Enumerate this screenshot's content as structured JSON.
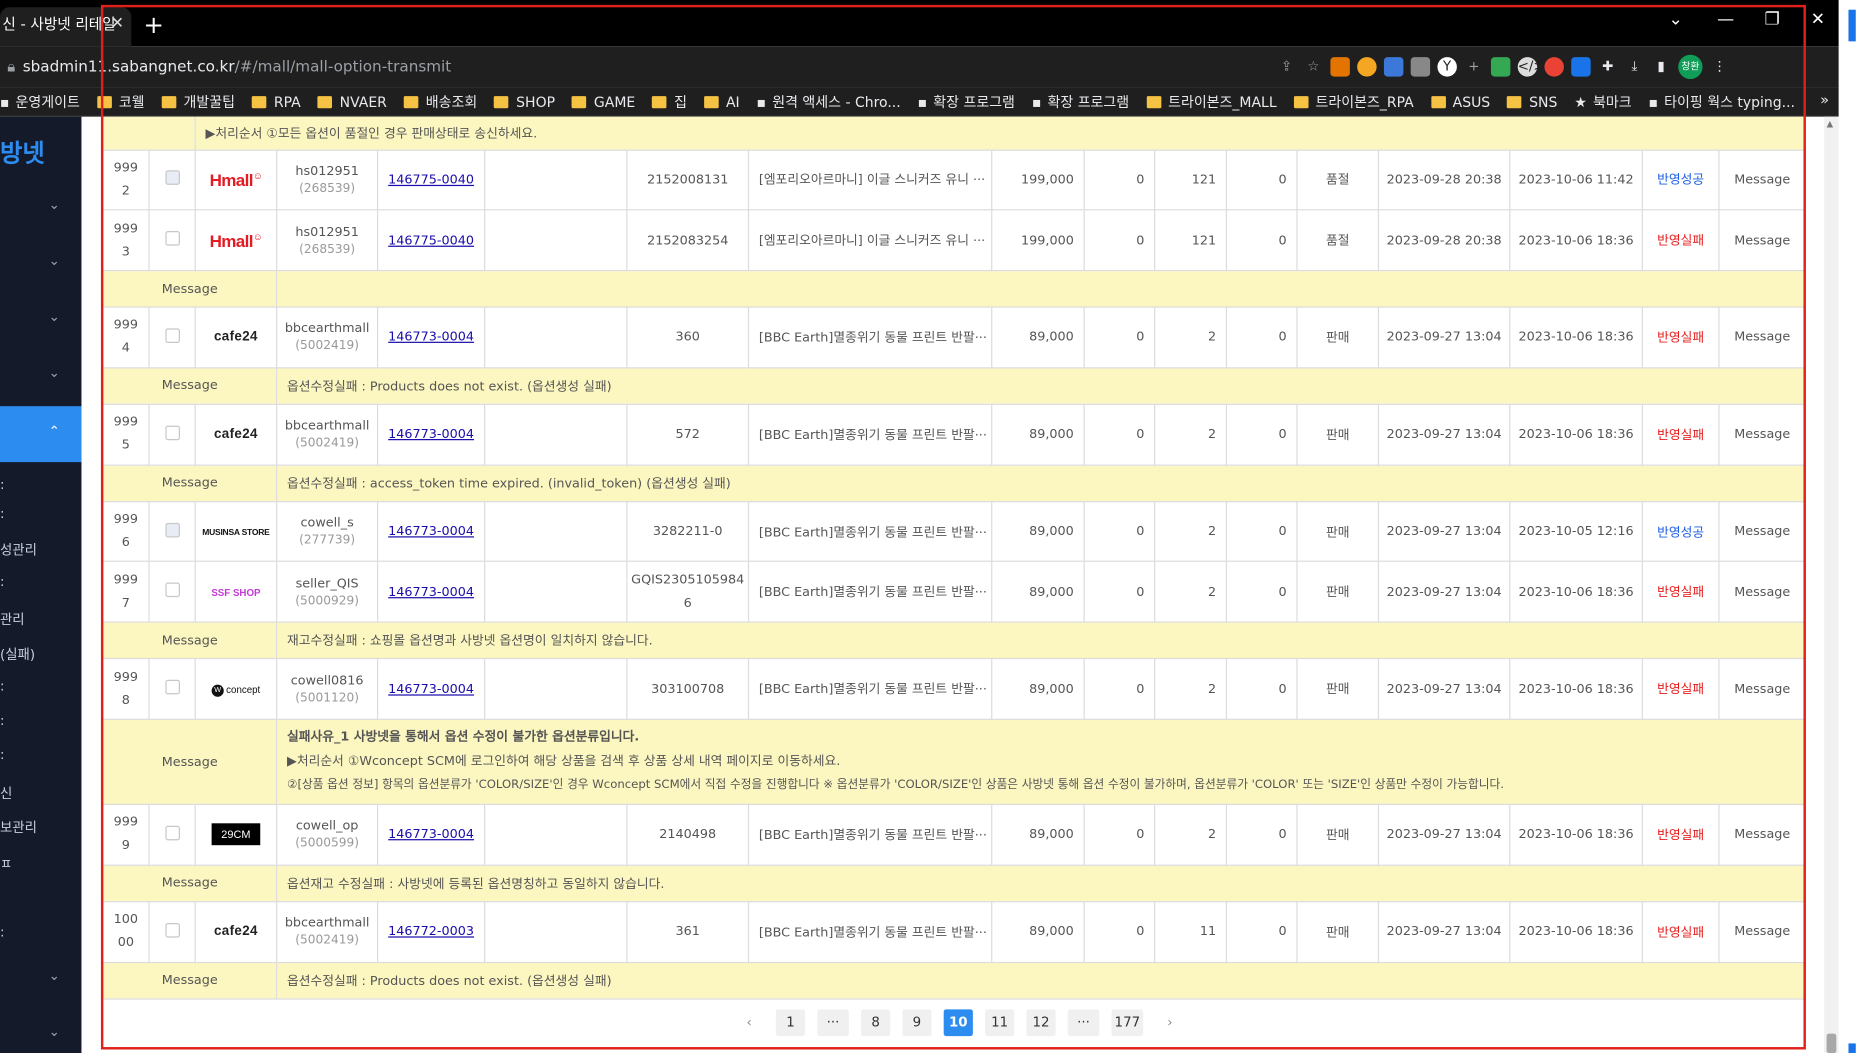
{
  "browser": {
    "tab_title": "신 - 사방넷 리테일",
    "tab_close": "✕",
    "new_tab": "+",
    "url_host": "sbadmin11.sabangnet.co.kr",
    "url_path": "/#/mall/mall-option-transmit",
    "window_controls": [
      "⌄",
      "—",
      "❐",
      "✕"
    ],
    "profile": "창환",
    "bookmarks": [
      {
        "label": "운영게이트",
        "icon": "site-icon"
      },
      {
        "label": "코웰",
        "icon": "folder-icon"
      },
      {
        "label": "개발꿀팁",
        "icon": "folder-icon"
      },
      {
        "label": "RPA",
        "icon": "folder-icon"
      },
      {
        "label": "NVAER",
        "icon": "folder-icon"
      },
      {
        "label": "배송조회",
        "icon": "folder-icon"
      },
      {
        "label": "SHOP",
        "icon": "folder-icon"
      },
      {
        "label": "GAME",
        "icon": "folder-icon"
      },
      {
        "label": "집",
        "icon": "folder-icon"
      },
      {
        "label": "AI",
        "icon": "folder-icon"
      },
      {
        "label": "원격 액세스 - Chro...",
        "icon": "remote-icon"
      },
      {
        "label": "확장 프로그램",
        "icon": "ext-icon"
      },
      {
        "label": "확장 프로그램",
        "icon": "puzzle-icon"
      },
      {
        "label": "트라이본즈_MALL",
        "icon": "folder-icon"
      },
      {
        "label": "트라이본즈_RPA",
        "icon": "folder-icon"
      },
      {
        "label": "ASUS",
        "icon": "folder-icon"
      },
      {
        "label": "SNS",
        "icon": "folder-icon"
      },
      {
        "label": "북마크",
        "icon": "star-icon"
      },
      {
        "label": "타이핑 웍스 typing...",
        "icon": "page-icon"
      }
    ],
    "bookmarks_more": "»"
  },
  "sidebar": {
    "logo": "방넷",
    "items": [
      "성관리",
      "관리",
      "(실패)",
      "신",
      "보관리",
      "ㅍ"
    ]
  },
  "table": {
    "top_message": "▶처리순서 ①모든 옵션이 품절인 경우 판매상태로 송신하세요.",
    "message_label": "Message",
    "rows": [
      {
        "no": [
          "999",
          "2"
        ],
        "mall": "Hmall",
        "account": "hs012951",
        "account_id": "(268539)",
        "code": "146775-0040",
        "opt": "",
        "mall_code": "2152008131",
        "product": "[엠포리오아르마니] 이글 스니커즈 유니 ···",
        "price": "199,000",
        "c1": "0",
        "c2": "121",
        "c3": "0",
        "status": "품절",
        "date1": "2023-09-28 20:38",
        "date2": "2023-10-06 11:42",
        "result": "반영성공",
        "result_type": "ok",
        "msg_btn": "Message",
        "checkbox_dim": true
      },
      {
        "no": [
          "999",
          "3"
        ],
        "mall": "Hmall",
        "account": "hs012951",
        "account_id": "(268539)",
        "code": "146775-0040",
        "opt": "",
        "mall_code": "2152083254",
        "product": "[엠포리오아르마니] 이글 스니커즈 유니 ···",
        "price": "199,000",
        "c1": "0",
        "c2": "121",
        "c3": "0",
        "status": "품절",
        "date1": "2023-09-28 20:38",
        "date2": "2023-10-06 18:36",
        "result": "반영실패",
        "result_type": "fail",
        "msg_btn": "Message",
        "message": ""
      },
      {
        "no": [
          "999",
          "4"
        ],
        "mall": "cafe24",
        "account": "bbcearthmall",
        "account_id": "(5002419)",
        "code": "146773-0004",
        "opt": "",
        "mall_code": "360",
        "product": "[BBC Earth]멸종위기 동물 프린트 반팔···",
        "price": "89,000",
        "c1": "0",
        "c2": "2",
        "c3": "0",
        "status": "판매",
        "date1": "2023-09-27 13:04",
        "date2": "2023-10-06 18:36",
        "result": "반영실패",
        "result_type": "fail",
        "msg_btn": "Message",
        "message": "옵션수정실패 : Products does not exist. (옵션생성 실패)"
      },
      {
        "no": [
          "999",
          "5"
        ],
        "mall": "cafe24",
        "account": "bbcearthmall",
        "account_id": "(5002419)",
        "code": "146773-0004",
        "opt": "",
        "mall_code": "572",
        "product": "[BBC Earth]멸종위기 동물 프린트 반팔···",
        "price": "89,000",
        "c1": "0",
        "c2": "2",
        "c3": "0",
        "status": "판매",
        "date1": "2023-09-27 13:04",
        "date2": "2023-10-06 18:36",
        "result": "반영실패",
        "result_type": "fail",
        "msg_btn": "Message",
        "message": "옵션수정실패 : access_token time expired. (invalid_token) (옵션생성 실패)"
      },
      {
        "no": [
          "999",
          "6"
        ],
        "mall": "MUSINSA STORE",
        "account": "cowell_s",
        "account_id": "(277739)",
        "code": "146773-0004",
        "opt": "",
        "mall_code": "3282211-0",
        "product": "[BBC Earth]멸종위기 동물 프린트 반팔···",
        "price": "89,000",
        "c1": "0",
        "c2": "2",
        "c3": "0",
        "status": "판매",
        "date1": "2023-09-27 13:04",
        "date2": "2023-10-05 12:16",
        "result": "반영성공",
        "result_type": "ok",
        "msg_btn": "Message",
        "checkbox_dim": true
      },
      {
        "no": [
          "999",
          "7"
        ],
        "mall": "SSF SHOP",
        "account": "seller_QIS",
        "account_id": "(5000929)",
        "code": "146773-0004",
        "opt": "",
        "mall_code": [
          "GQIS2305105984",
          "6"
        ],
        "product": "[BBC Earth]멸종위기 동물 프린트 반팔···",
        "price": "89,000",
        "c1": "0",
        "c2": "2",
        "c3": "0",
        "status": "판매",
        "date1": "2023-09-27 13:04",
        "date2": "2023-10-06 18:36",
        "result": "반영실패",
        "result_type": "fail",
        "msg_btn": "Message",
        "message": "재고수정실패 : 쇼핑몰 옵션명과 사방넷 옵션명이 일치하지 않습니다."
      },
      {
        "no": [
          "999",
          "8"
        ],
        "mall": "concept",
        "account": "cowell0816",
        "account_id": "(5001120)",
        "code": "146773-0004",
        "opt": "",
        "mall_code": "303100708",
        "product": "[BBC Earth]멸종위기 동물 프린트 반팔···",
        "price": "89,000",
        "c1": "0",
        "c2": "2",
        "c3": "0",
        "status": "판매",
        "date1": "2023-09-27 13:04",
        "date2": "2023-10-06 18:36",
        "result": "반영실패",
        "result_type": "fail",
        "msg_btn": "Message",
        "message_lines": [
          "실패사유_1  사방넷을 통해서 옵션 수정이 불가한 옵션분류입니다.",
          "▶처리순서  ①Wconcept SCM에 로그인하여 해당 상품을 검색 후 상품 상세 내역 페이지로 이동하세요.",
          "②[상품 옵션 정보] 항목의 옵션분류가 'COLOR/SIZE'인 경우 Wconcept SCM에서 직접 수정을 진행합니다 ※ 옵션분류가 'COLOR/SIZE'인 상품은 사방넷 통해 옵션 수정이 불가하며, 옵션분류가 'COLOR' 또는 'SIZE'인 상품만 수정이 가능합니다."
        ]
      },
      {
        "no": [
          "999",
          "9"
        ],
        "mall": "29CM",
        "account": "cowell_op",
        "account_id": "(5000599)",
        "code": "146773-0004",
        "opt": "",
        "mall_code": "2140498",
        "product": "[BBC Earth]멸종위기 동물 프린트 반팔···",
        "price": "89,000",
        "c1": "0",
        "c2": "2",
        "c3": "0",
        "status": "판매",
        "date1": "2023-09-27 13:04",
        "date2": "2023-10-06 18:36",
        "result": "반영실패",
        "result_type": "fail",
        "msg_btn": "Message",
        "message": "옵션재고 수정실패 : 사방넷에 등록된 옵션명칭하고 동일하지 않습니다."
      },
      {
        "no": [
          "100",
          "00"
        ],
        "mall": "cafe24",
        "account": "bbcearthmall",
        "account_id": "(5002419)",
        "code": "146772-0003",
        "opt": "",
        "mall_code": "361",
        "product": "[BBC Earth]멸종위기 동물 프린트 반팔···",
        "price": "89,000",
        "c1": "0",
        "c2": "11",
        "c3": "0",
        "status": "판매",
        "date1": "2023-09-27 13:04",
        "date2": "2023-10-06 18:36",
        "result": "반영실패",
        "result_type": "fail",
        "msg_btn": "Message",
        "message": "옵션수정실패 : Products does not exist. (옵션생성 실패)"
      }
    ]
  },
  "pagination": {
    "prev": "‹",
    "next": "›",
    "pages": [
      "1",
      "···",
      "8",
      "9",
      "10",
      "11",
      "12",
      "···",
      "177"
    ],
    "active": "10"
  },
  "colors": {
    "accent": "#2d8cf0",
    "fail": "#e61c1c",
    "ok": "#1c5ee6",
    "message_bg": "#fcf7c0",
    "highlight_frame": "#e0201b"
  }
}
